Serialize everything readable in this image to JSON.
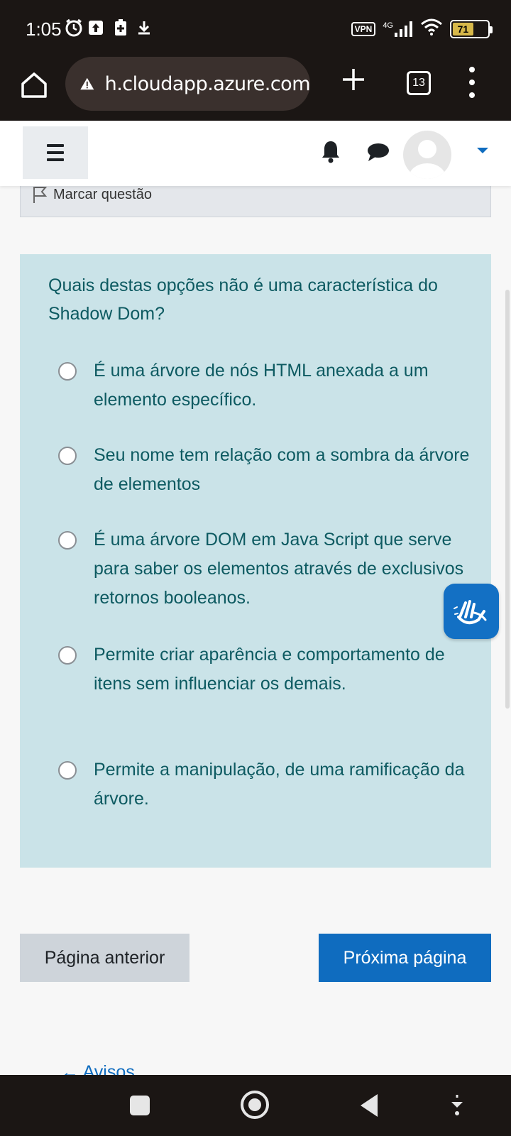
{
  "status_bar": {
    "time": "1:05",
    "vpn": "VPN",
    "network": "4G",
    "battery": "71"
  },
  "browser": {
    "url": "h.cloudapp.azure.com",
    "tab_count": "13"
  },
  "flag": {
    "label": "Marcar questão"
  },
  "question": {
    "text": "Quais destas opções não é uma característica do Shadow Dom?",
    "options": [
      {
        "label": "É uma árvore de nós HTML anexada a um elemento específico."
      },
      {
        "label": "Seu nome tem relação com a sombra da árvore de elementos"
      },
      {
        "label": "É uma árvore DOM em Java Script que serve para saber os elementos através de exclusivos retornos booleanos."
      },
      {
        "label": "Permite  criar aparência e comportamento de itens sem influenciar os demais."
      },
      {
        "label": "Permite a manipulação, de uma ramificação da árvore."
      }
    ]
  },
  "navigation": {
    "prev_label": "Página anterior",
    "next_label": "Próxima página",
    "avisos_label": "Avisos"
  },
  "colors": {
    "accent": "#0f6cbf",
    "question_bg": "#cae3e8",
    "question_text": "#0d5a61"
  }
}
